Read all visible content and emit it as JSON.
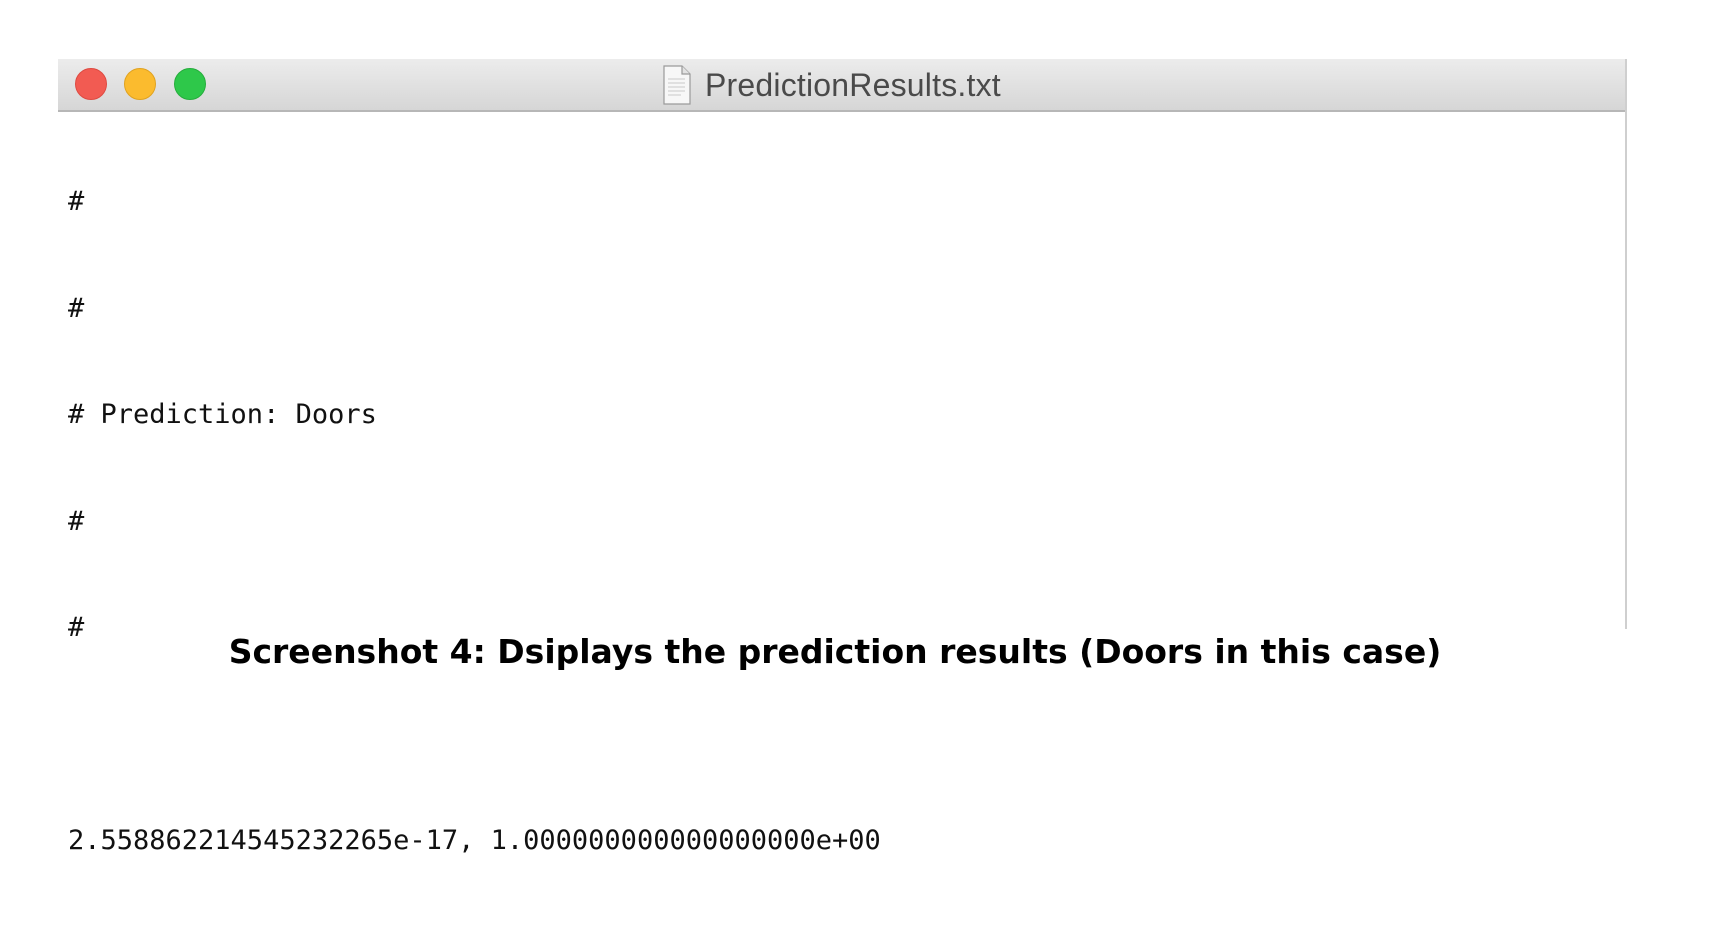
{
  "window": {
    "title": "PredictionResults.txt",
    "traffic_lights": {
      "close_color": "#f25b52",
      "minimize_color": "#fbbb2e",
      "maximize_color": "#2ec84a"
    },
    "file_icon": "document-icon"
  },
  "file_content": {
    "lines": [
      "#",
      "#",
      "# Prediction: Doors",
      "#",
      "#",
      "",
      "2.558862214545232265e-17, 1.000000000000000000e+00"
    ]
  },
  "caption": "Screenshot 4: Dsiplays the prediction results (Doors in this case)"
}
